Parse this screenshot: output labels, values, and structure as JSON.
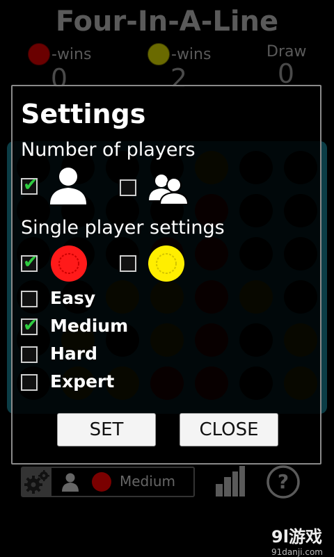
{
  "header": {
    "title": "Four-In-A-Line",
    "red_wins_label": "-wins",
    "yellow_wins_label": "-wins",
    "draw_label": "Draw",
    "red_wins": "0",
    "yellow_wins": "2",
    "draws": "0"
  },
  "dialog": {
    "title": "Settings",
    "players_section": "Number of players",
    "single_section": "Single player settings",
    "one_player_checked": true,
    "two_player_checked": false,
    "red_checked": true,
    "yellow_checked": false,
    "difficulty": [
      {
        "label": "Easy",
        "checked": false
      },
      {
        "label": "Medium",
        "checked": true
      },
      {
        "label": "Hard",
        "checked": false
      },
      {
        "label": "Expert",
        "checked": false
      }
    ],
    "set_label": "SET",
    "close_label": "CLOSE"
  },
  "bottom": {
    "level_label": "Medium"
  },
  "watermark": {
    "brand": "9l游戏",
    "url": "91danji.com"
  },
  "colors": {
    "red": "#ff1a1a",
    "yellow": "#ffee00",
    "check": "#2ecc40",
    "board": "#0b3d46"
  }
}
